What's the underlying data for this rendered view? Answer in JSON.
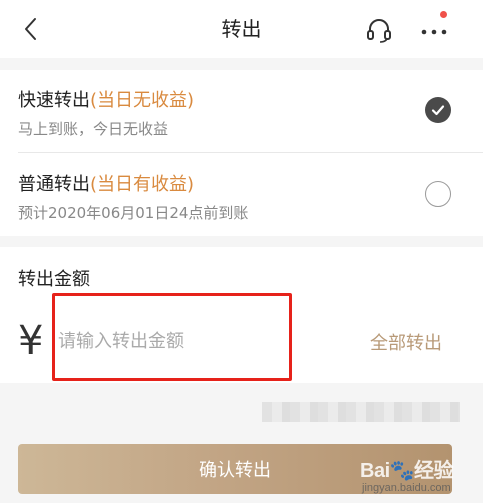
{
  "nav": {
    "title": "转出",
    "back_icon": "chevron-left-icon",
    "support_icon": "headset-icon",
    "more_icon": "more-dots-icon",
    "notification_dot_color": "#f0514a"
  },
  "options": [
    {
      "title": "快速转出",
      "tag": "(当日无收益)",
      "subtitle": "马上到账，今日无收益",
      "selected": true
    },
    {
      "title": "普通转出",
      "tag": "(当日有收益)",
      "subtitle": "预计2020年06月01日24点前到账",
      "selected": false
    }
  ],
  "amount": {
    "label": "转出金额",
    "currency_symbol": "¥",
    "placeholder": "请输入转出金额",
    "value": "",
    "all_label": "全部转出"
  },
  "confirm": {
    "label": "确认转出"
  },
  "watermark": {
    "brand": "Bai",
    "brand_suffix": "经验",
    "url": "jingyan.baidu.com"
  },
  "colors": {
    "accent_tag": "#d98a3f",
    "all_link": "#b89a78",
    "confirm_start": "#cdb797",
    "confirm_end": "#b3936f",
    "highlight_box": "#e6221a"
  }
}
